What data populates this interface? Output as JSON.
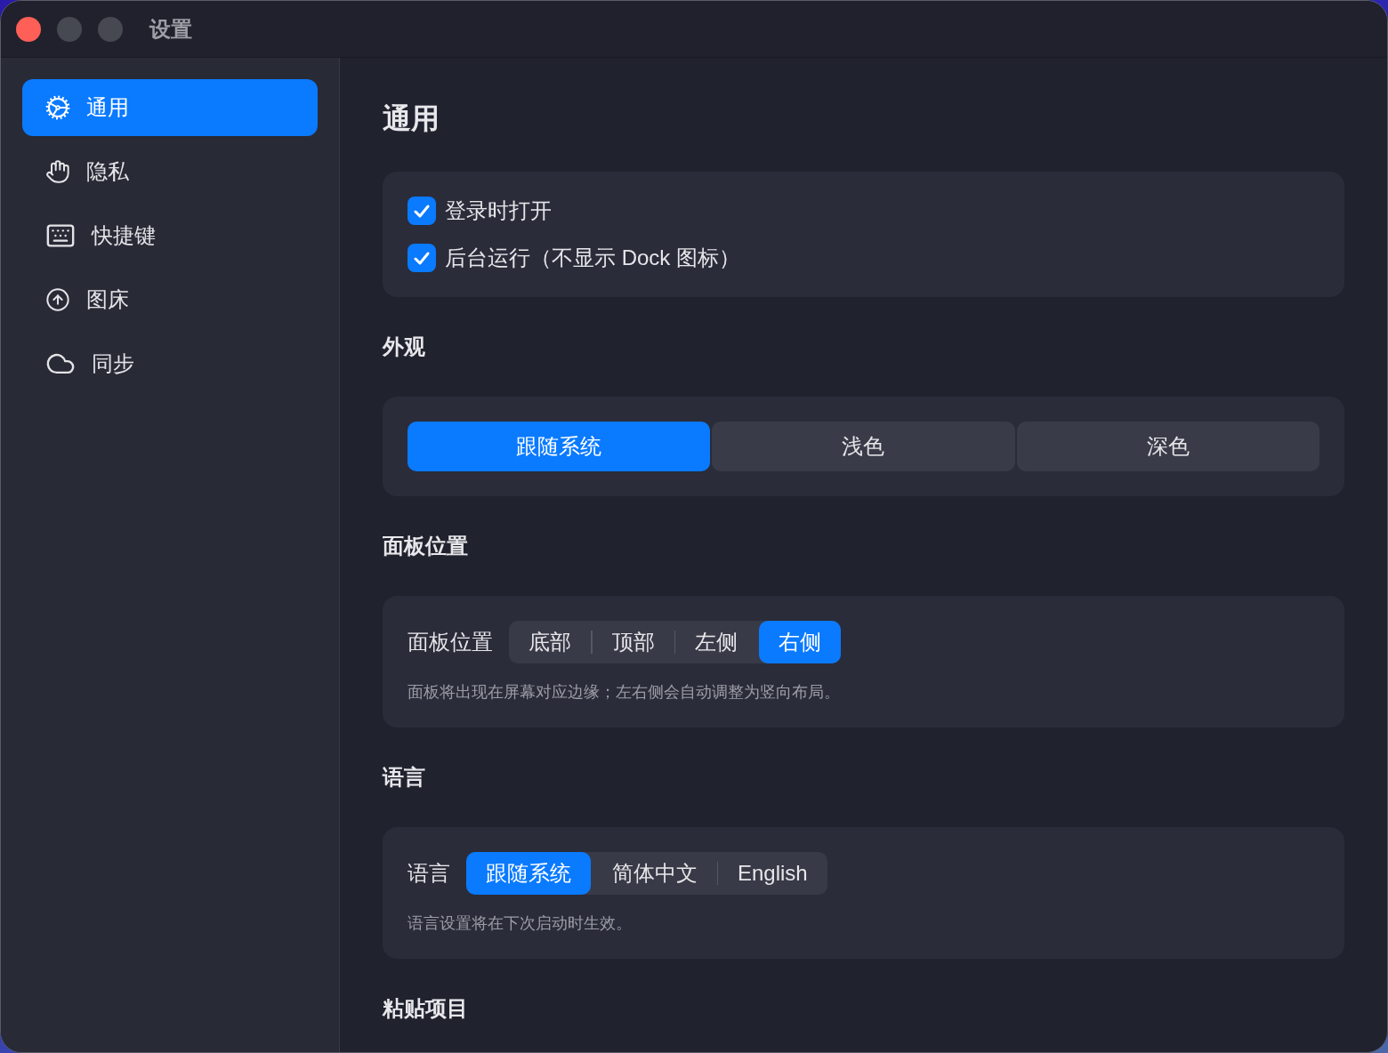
{
  "window": {
    "title": "设置"
  },
  "sidebar": {
    "items": [
      {
        "label": "通用",
        "selected": true
      },
      {
        "label": "隐私",
        "selected": false
      },
      {
        "label": "快捷键",
        "selected": false
      },
      {
        "label": "图床",
        "selected": false
      },
      {
        "label": "同步",
        "selected": false
      }
    ]
  },
  "page": {
    "title": "通用"
  },
  "startup": {
    "options": [
      {
        "label": "登录时打开",
        "checked": true
      },
      {
        "label": "后台运行（不显示 Dock 图标）",
        "checked": true
      }
    ]
  },
  "appearance": {
    "heading": "外观",
    "options": [
      {
        "label": "跟随系统",
        "selected": true
      },
      {
        "label": "浅色",
        "selected": false
      },
      {
        "label": "深色",
        "selected": false
      }
    ]
  },
  "panel_position": {
    "heading": "面板位置",
    "label": "面板位置",
    "options": [
      {
        "label": "底部",
        "selected": false
      },
      {
        "label": "顶部",
        "selected": false
      },
      {
        "label": "左侧",
        "selected": false
      },
      {
        "label": "右侧",
        "selected": true
      }
    ],
    "hint": "面板将出现在屏幕对应边缘；左右侧会自动调整为竖向布局。"
  },
  "language": {
    "heading": "语言",
    "label": "语言",
    "options": [
      {
        "label": "跟随系统",
        "selected": true
      },
      {
        "label": "简体中文",
        "selected": false
      },
      {
        "label": "English",
        "selected": false
      }
    ],
    "hint": "语言设置将在下次启动时生效。"
  },
  "paste_items": {
    "heading": "粘贴项目"
  }
}
